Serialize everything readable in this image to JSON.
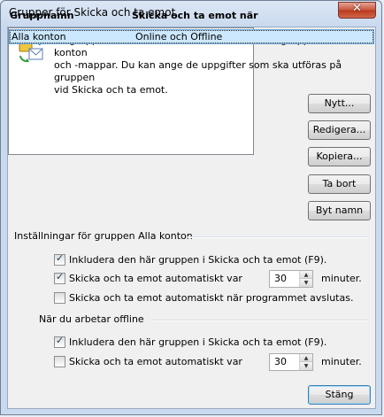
{
  "window": {
    "title": "Grupper för Skicka och ta emot",
    "close_symbol": "✕"
  },
  "intro": {
    "text": "En grupp för Skicka och ta emot innehåller en grupp Outlook-konton\noch -mappar. Du kan ange de uppgifter som ska utföras på gruppen\nvid Skicka och ta emot."
  },
  "list": {
    "headers": [
      "Gruppnamn",
      "Skicka och ta emot när"
    ],
    "rows": [
      {
        "name": "Alla konton",
        "when": "Online och Offline"
      }
    ]
  },
  "buttons": {
    "new": "Nytt...",
    "edit": "Redigera...",
    "copy": "Kopiera...",
    "remove": "Ta bort",
    "rename": "Byt namn",
    "close": "Stäng"
  },
  "online_group": {
    "label": "Inställningar för gruppen Alla konton",
    "include": {
      "label": "Inkludera den här gruppen i Skicka och ta emot (F9).",
      "checked": true
    },
    "auto": {
      "label": "Skicka och ta emot automatiskt var",
      "checked": true,
      "value": "30",
      "unit": "minuter."
    },
    "on_exit": {
      "label": "Skicka och ta emot automatiskt när programmet avslutas.",
      "checked": false
    }
  },
  "offline_group": {
    "label": "När du arbetar offline",
    "include": {
      "label": "Inkludera den här gruppen i Skicka och ta emot (F9).",
      "checked": true
    },
    "auto": {
      "label": "Skicka och ta emot automatiskt var",
      "checked": false,
      "value": "30",
      "unit": "minuter."
    }
  }
}
